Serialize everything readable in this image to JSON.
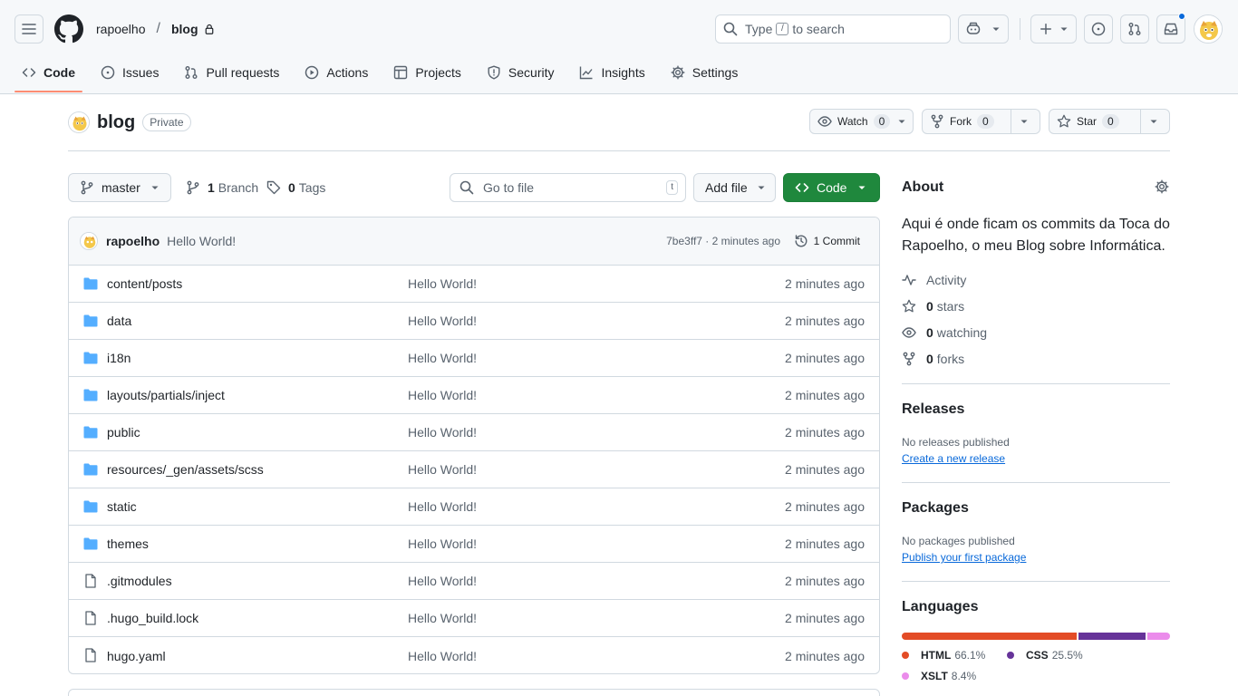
{
  "header": {
    "owner": "rapoelho",
    "separator": "/",
    "repo": "blog",
    "search_prefix": "Type",
    "search_key": "/",
    "search_suffix": "to search"
  },
  "nav": {
    "tabs": [
      {
        "label": "Code",
        "icon": "code-icon",
        "active": true
      },
      {
        "label": "Issues",
        "icon": "issue-icon"
      },
      {
        "label": "Pull requests",
        "icon": "pull-request-icon"
      },
      {
        "label": "Actions",
        "icon": "play-icon"
      },
      {
        "label": "Projects",
        "icon": "table-icon"
      },
      {
        "label": "Security",
        "icon": "shield-icon"
      },
      {
        "label": "Insights",
        "icon": "graph-icon"
      },
      {
        "label": "Settings",
        "icon": "gear-icon"
      }
    ]
  },
  "repo": {
    "name": "blog",
    "visibility": "Private",
    "watch_label": "Watch",
    "watch_count": "0",
    "fork_label": "Fork",
    "fork_count": "0",
    "star_label": "Star",
    "star_count": "0"
  },
  "toolbar": {
    "branch": "master",
    "branch_count": "1",
    "branch_label": "Branch",
    "tag_count": "0",
    "tag_label": "Tags",
    "goto_placeholder": "Go to file",
    "goto_key": "t",
    "add_file": "Add file",
    "code": "Code"
  },
  "commit": {
    "author": "rapoelho",
    "message": "Hello World!",
    "meta": "7be3ff7 · 2 minutes ago",
    "count": "1 Commit"
  },
  "files": [
    {
      "name": "content/posts",
      "type": "folder",
      "message": "Hello World!",
      "age": "2 minutes ago"
    },
    {
      "name": "data",
      "type": "folder",
      "message": "Hello World!",
      "age": "2 minutes ago"
    },
    {
      "name": "i18n",
      "type": "folder",
      "message": "Hello World!",
      "age": "2 minutes ago"
    },
    {
      "name": "layouts/partials/inject",
      "type": "folder",
      "message": "Hello World!",
      "age": "2 minutes ago"
    },
    {
      "name": "public",
      "type": "folder",
      "message": "Hello World!",
      "age": "2 minutes ago"
    },
    {
      "name": "resources/_gen/assets/scss",
      "type": "folder",
      "message": "Hello World!",
      "age": "2 minutes ago"
    },
    {
      "name": "static",
      "type": "folder",
      "message": "Hello World!",
      "age": "2 minutes ago"
    },
    {
      "name": "themes",
      "type": "folder",
      "message": "Hello World!",
      "age": "2 minutes ago"
    },
    {
      "name": ".gitmodules",
      "type": "file",
      "message": "Hello World!",
      "age": "2 minutes ago"
    },
    {
      "name": ".hugo_build.lock",
      "type": "file",
      "message": "Hello World!",
      "age": "2 minutes ago"
    },
    {
      "name": "hugo.yaml",
      "type": "file",
      "message": "Hello World!",
      "age": "2 minutes ago"
    }
  ],
  "about": {
    "heading": "About",
    "description": "Aqui é onde ficam os commits da Toca do Rapoelho, o meu Blog sobre Informática.",
    "activity": "Activity",
    "stars_count": "0",
    "stars_label": "stars",
    "watching_count": "0",
    "watching_label": "watching",
    "forks_count": "0",
    "forks_label": "forks"
  },
  "releases": {
    "heading": "Releases",
    "empty": "No releases published",
    "link": "Create a new release"
  },
  "packages": {
    "heading": "Packages",
    "empty": "No packages published",
    "link": "Publish your first package"
  },
  "languages": {
    "heading": "Languages",
    "items": [
      {
        "name": "HTML",
        "percent": "66.1%",
        "share": 66.1,
        "color": "#e34c26"
      },
      {
        "name": "CSS",
        "percent": "25.5%",
        "share": 25.5,
        "color": "#663399"
      },
      {
        "name": "XSLT",
        "percent": "8.4%",
        "share": 8.4,
        "color": "#eb8ceb"
      }
    ]
  },
  "colors": {
    "accent_link": "#0969da",
    "code_button": "#1f883d",
    "nav_underline": "#fd8c73",
    "folder": "#54aeff"
  }
}
